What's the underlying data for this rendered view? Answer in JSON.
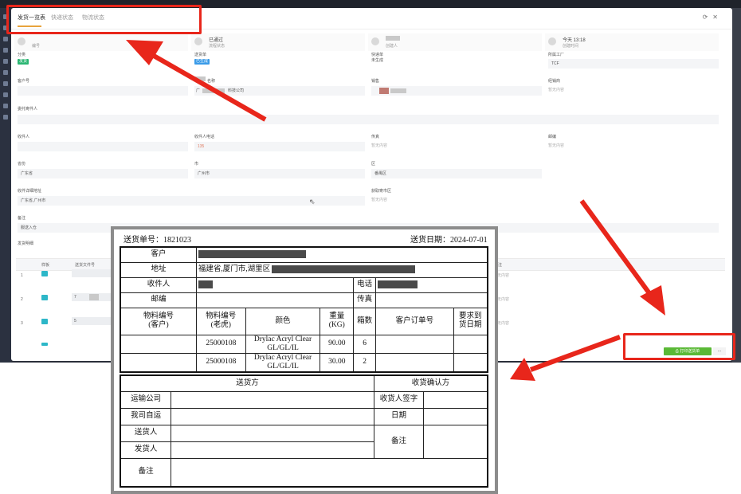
{
  "modal": {
    "tabs": [
      "发货一览表",
      "快递状态",
      "物流状态"
    ],
    "info_cards": [
      {
        "value": "",
        "label": "编号"
      },
      {
        "value": "已通过",
        "label": "流程状态"
      },
      {
        "value": "",
        "label": "创建人"
      },
      {
        "value": "今天 13:18",
        "label": "创建时间"
      }
    ],
    "fields": {
      "category": {
        "label": "分类",
        "tag": "发货"
      },
      "delivery_note": {
        "label": "送货单",
        "tag": "已生成"
      },
      "courier": {
        "label": "快递单",
        "value": "未生成"
      },
      "factory": {
        "label": "所属工厂",
        "value": "TCF"
      },
      "customer_no": {
        "label": "客户号"
      },
      "company_name": {
        "label": "名称",
        "value_prefix": "广",
        "value_suffix": "料技公司"
      },
      "sales": {
        "label": "销售"
      },
      "dealer": {
        "label": "经销商",
        "value": "暂无内容"
      },
      "consignor": {
        "label": "委托寄件人"
      },
      "receiver": {
        "label": "收件人"
      },
      "receiver_phone": {
        "label": "收件人电话",
        "value": "135"
      },
      "fax": {
        "label": "传真",
        "value": "暂无内容"
      },
      "postcode": {
        "label": "邮编",
        "value": "暂无内容"
      },
      "province": {
        "label": "省份",
        "value": "广东省"
      },
      "city": {
        "label": "市",
        "value": "广州市"
      },
      "district": {
        "label": "区",
        "value": "番禺区"
      },
      "address": {
        "label": "收件详细地址",
        "value": "广东省,广州市"
      },
      "pickup_district": {
        "label": "获取寄市区",
        "value": "暂无内容"
      },
      "remark": {
        "label": "备注",
        "value": "服送入仓"
      }
    },
    "detail_section": {
      "title": "发货明细",
      "columns": [
        "样板",
        "送货文件号",
        "注"
      ],
      "rows": [
        {
          "no": "1"
        },
        {
          "no": "2",
          "file": "7"
        },
        {
          "no": "3",
          "file": "5"
        }
      ],
      "empty_text": "暂无内容"
    },
    "buttons": {
      "print": "打印送货单",
      "more": "..."
    }
  },
  "delivery_note": {
    "number_label": "送货单号：1821023",
    "date_label": "送货日期：2024-07-01",
    "customer_label": "客户",
    "address_label": "地址",
    "address_value": "福建省,厦门市,湖里区",
    "receiver_label": "收件人",
    "phone_label": "电话",
    "postcode_label": "邮编",
    "fax_label": "传真",
    "col_customer_code": "物料编号\n(客户)",
    "col_laohu_code": "物料编号\n(老虎)",
    "col_color": "颜色",
    "col_weight": "重量\n(KG)",
    "col_boxes": "箱数",
    "col_order_no": "客户订单号",
    "col_required_date": "要求到\n货日期",
    "items": [
      {
        "code": "25000108",
        "color": "Drylac Acryl Clear GL/GL/IL",
        "weight": "90.00",
        "boxes": "6"
      },
      {
        "code": "25000108",
        "color": "Drylac Acryl Clear GL/GL/IL",
        "weight": "30.00",
        "boxes": "2"
      }
    ],
    "sender_party": "送货方",
    "receiver_confirm": "收货确认方",
    "transport_company": "运输公司",
    "self_delivery": "我司自运",
    "delivery_person": "送货人",
    "shipper": "发货人",
    "remark": "备注",
    "receiver_sign": "收货人签字",
    "date": "日期",
    "remark2": "备注"
  },
  "colors": {
    "highlight": "#e8261b",
    "accent": "#e8a33d",
    "print_button": "#5ab936"
  }
}
